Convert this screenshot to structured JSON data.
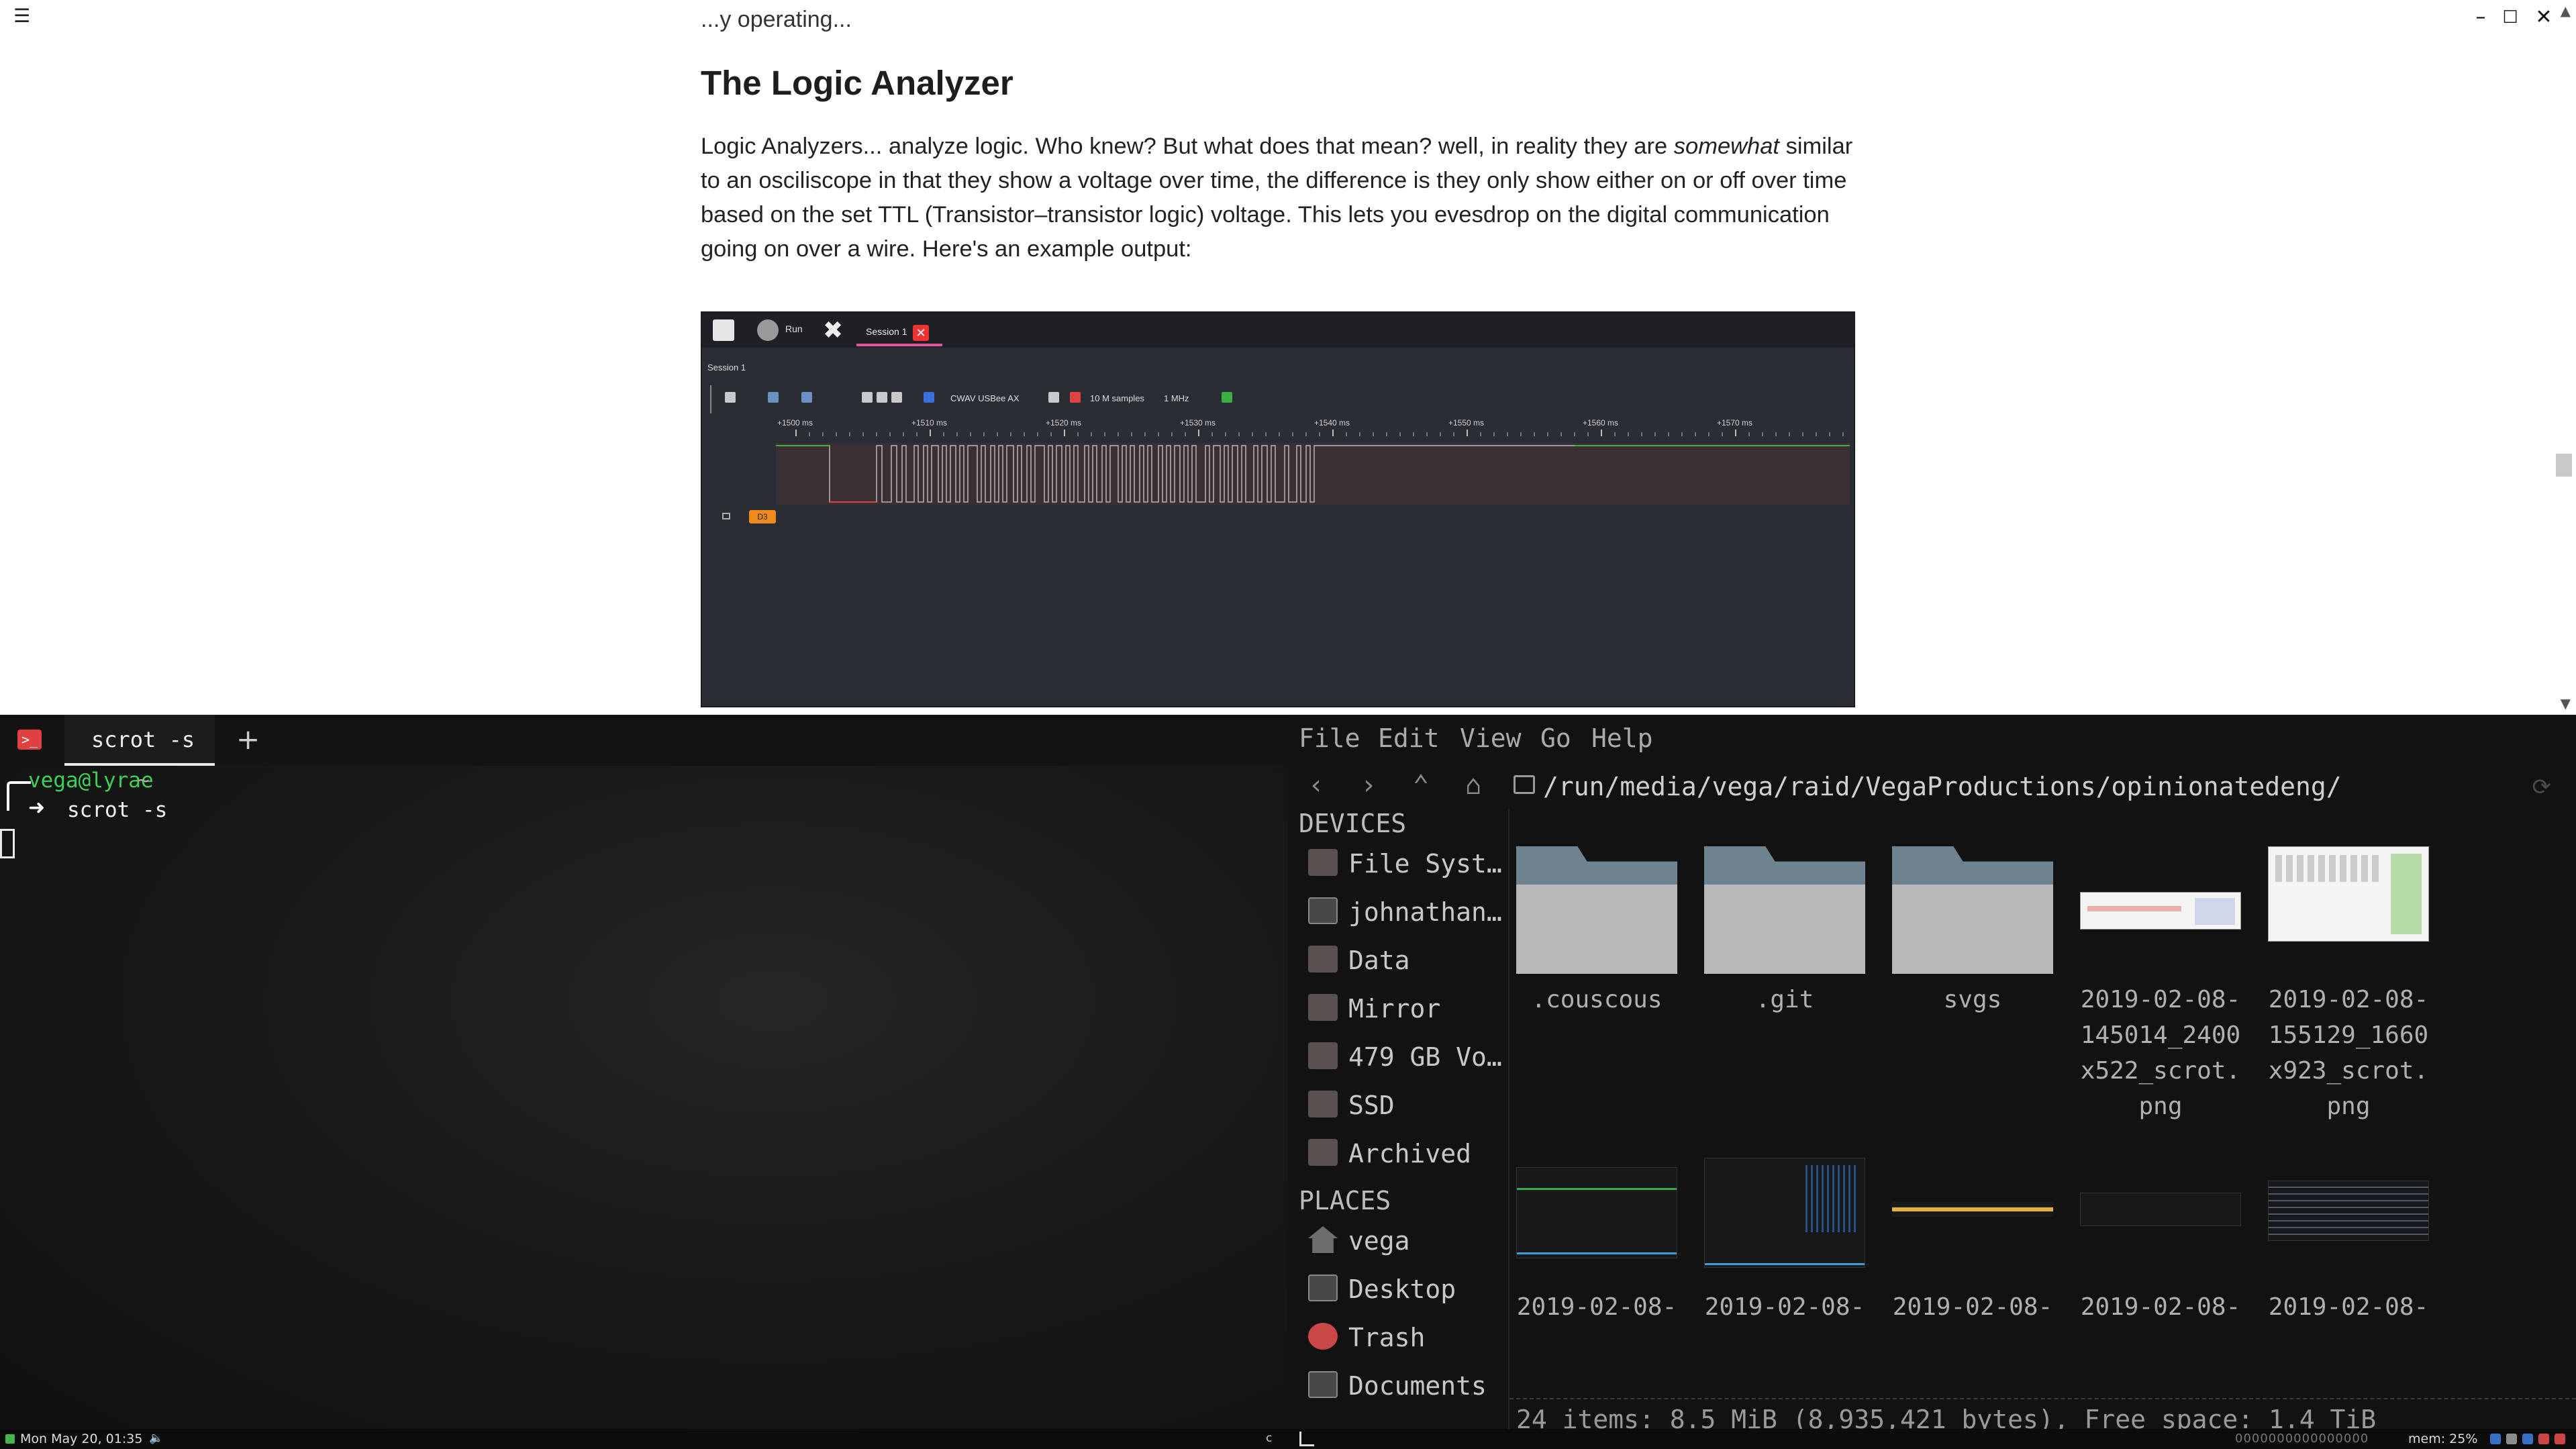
{
  "document": {
    "top_cut_text": "...y operating...",
    "heading": "The Logic Analyzer",
    "paragraph_part1": "Logic Analyzers... analyze logic. Who knew? But what does that mean? well, in reality they are ",
    "paragraph_emphasis": "somewhat",
    "paragraph_part2": " similar to an osciliscope in that they show a voltage over time, the difference is they only show either on or off over time based on the set TTL (Transistor–transistor logic) voltage. This lets you evesdrop on the digital communication going on over a wire. Here's an example output:"
  },
  "logic_analyzer": {
    "run_label": "Run",
    "session_tab": "Session 1",
    "session_title": "Session 1",
    "device": "CWAV USBee AX",
    "samples": "10 M samples",
    "rate": "1 MHz",
    "channel": "D3",
    "time_ticks": [
      "+1500 ms",
      "+1510 ms",
      "+1520 ms",
      "+1530 ms",
      "+1540 ms",
      "+1550 ms",
      "+1560 ms",
      "+1570 ms"
    ]
  },
  "terminal": {
    "tab_label": "scrot -s",
    "prompt_user": "vega@lyrae",
    "prompt_dir": "~",
    "command": "scrot -s"
  },
  "file_manager": {
    "menu": [
      "File",
      "Edit",
      "View",
      "Go",
      "Help"
    ],
    "path": "/run/media/vega/raid/VegaProductions/opinionatedeng/",
    "sections": {
      "devices": "DEVICES",
      "places": "PLACES"
    },
    "devices": [
      "File Syst…",
      "johnathan…",
      "Data",
      "Mirror",
      "479 GB Vo…",
      "SSD",
      "Archived"
    ],
    "places": [
      "vega",
      "Desktop",
      "Trash",
      "Documents"
    ],
    "files_row1": [
      ".couscous",
      ".git",
      "svgs",
      "2019-02-08-145014_2400x522_scrot.png",
      "2019-02-08-155129_1660x923_scrot.png"
    ],
    "files_row2": [
      "2019-02-08-",
      "2019-02-08-",
      "2019-02-08-",
      "2019-02-08-",
      "2019-02-08-"
    ],
    "status": "24 items: 8.5 MiB (8,935,421 bytes), Free space: 1.4 TiB"
  },
  "taskbar": {
    "clock": "Mon May 20, 01:35",
    "workspace": "c",
    "cpu_graph": "0000000000000000",
    "memory": "mem: 25%"
  },
  "colors": {
    "accent_pink": "#e0559a",
    "prompt_green": "#39d353",
    "close_red": "#e33333"
  }
}
